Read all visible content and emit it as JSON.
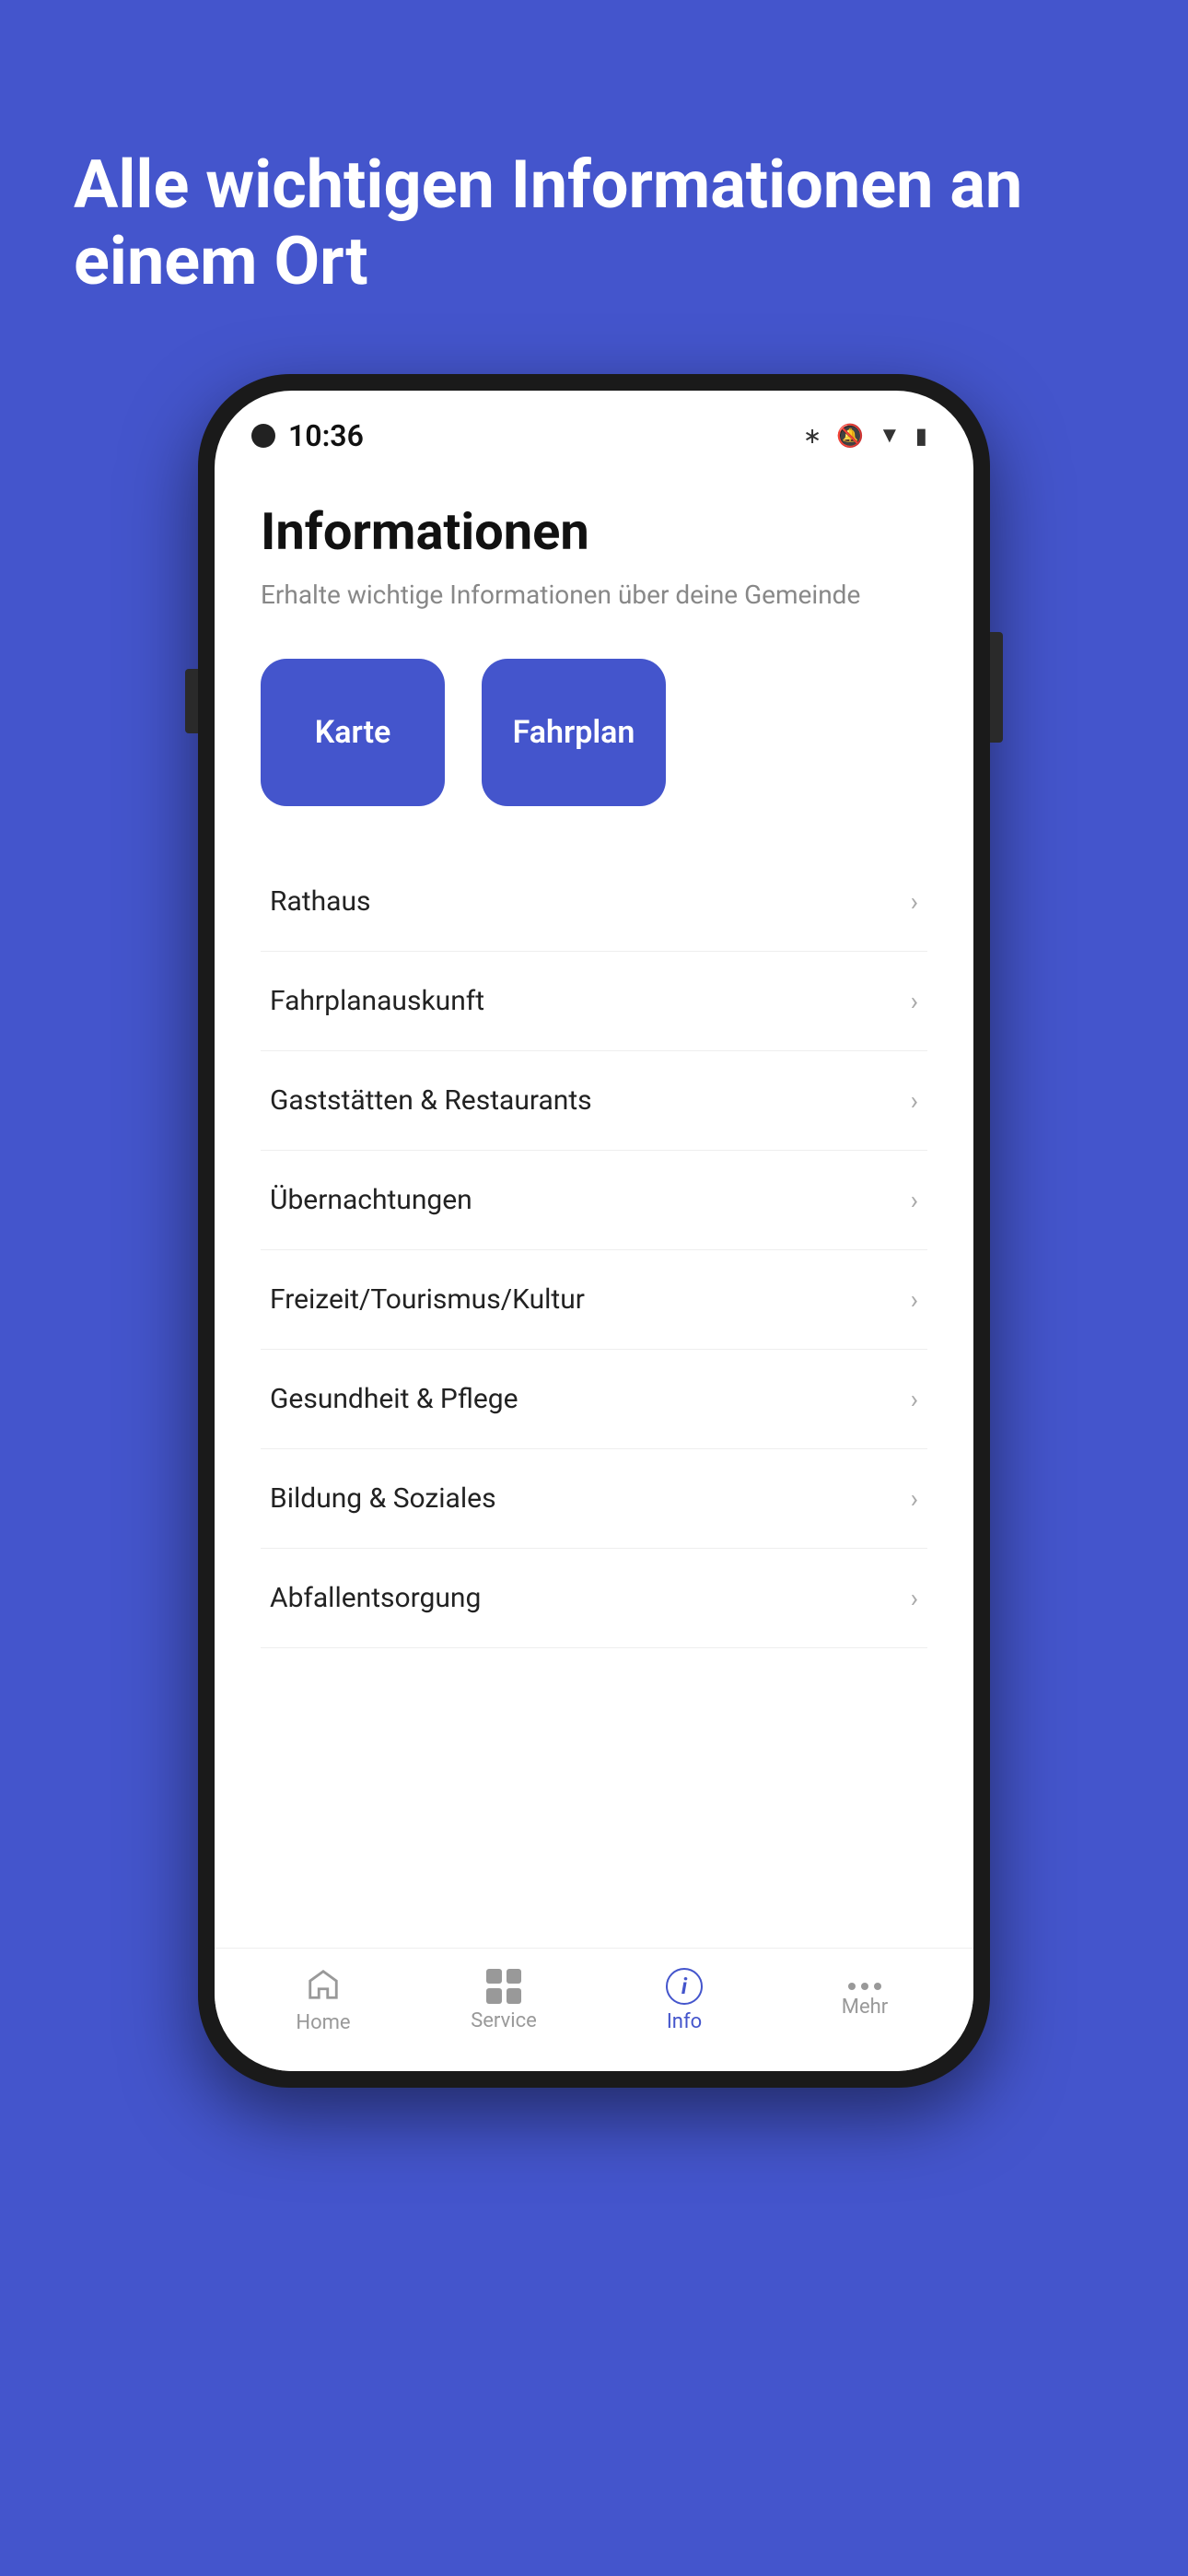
{
  "background_color": "#4455cc",
  "hero": {
    "title": "Alle wichtigen Informationen an einem Ort"
  },
  "phone": {
    "status_bar": {
      "time": "10:36",
      "icons": [
        "bluetooth",
        "bell-off",
        "wifi",
        "battery"
      ]
    },
    "app": {
      "title": "Informationen",
      "subtitle": "Erhalte wichtige Informationen über deine Gemeinde",
      "quick_buttons": [
        {
          "label": "Karte"
        },
        {
          "label": "Fahrplan"
        }
      ],
      "menu_items": [
        {
          "label": "Rathaus"
        },
        {
          "label": "Fahrplanauskunft"
        },
        {
          "label": "Gaststätten & Restaurants"
        },
        {
          "label": "Übernachtungen"
        },
        {
          "label": "Freizeit/Tourismus/Kultur"
        },
        {
          "label": "Gesundheit & Pflege"
        },
        {
          "label": "Bildung & Soziales"
        },
        {
          "label": "Abfallentsorgung"
        }
      ]
    },
    "bottom_nav": [
      {
        "label": "Home",
        "icon": "home",
        "active": false
      },
      {
        "label": "Service",
        "icon": "grid",
        "active": false
      },
      {
        "label": "Info",
        "icon": "info-circle",
        "active": true
      },
      {
        "label": "Mehr",
        "icon": "dots",
        "active": false
      }
    ]
  }
}
